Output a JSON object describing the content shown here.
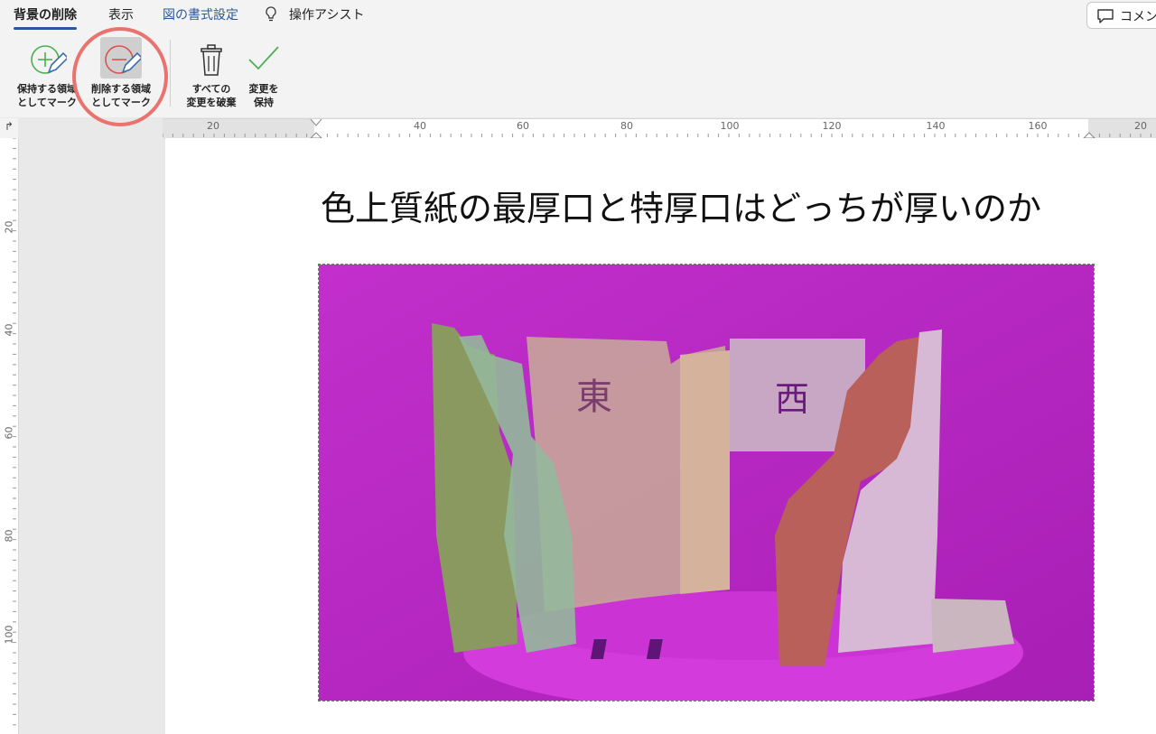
{
  "tabs": {
    "remove_bg": "背景の削除",
    "view": "表示",
    "picture_format": "図の書式設定",
    "tell_me": "操作アシスト",
    "comments": "コメント"
  },
  "ribbon": {
    "mark_keep": "保持する領域\nとしてマーク",
    "mark_remove": "削除する領域\nとしてマーク",
    "discard_all": "すべての\n変更を破棄",
    "keep_changes": "変更を\n保持"
  },
  "ruler": {
    "h_numbers": [
      "20",
      "20",
      "40",
      "60",
      "80",
      "100",
      "120",
      "140",
      "160"
    ],
    "v_numbers": [
      "20",
      "40",
      "60",
      "80",
      "100"
    ],
    "corner": "↱"
  },
  "document": {
    "heading": "色上質紙の最厚口と特厚口はどっちが厚いのか",
    "image_labels": {
      "east": "東",
      "west": "西"
    }
  },
  "colors": {
    "accent": "#2b579a",
    "removal_overlay": "#b82cc4",
    "highlight_circle": "#e8736f"
  }
}
